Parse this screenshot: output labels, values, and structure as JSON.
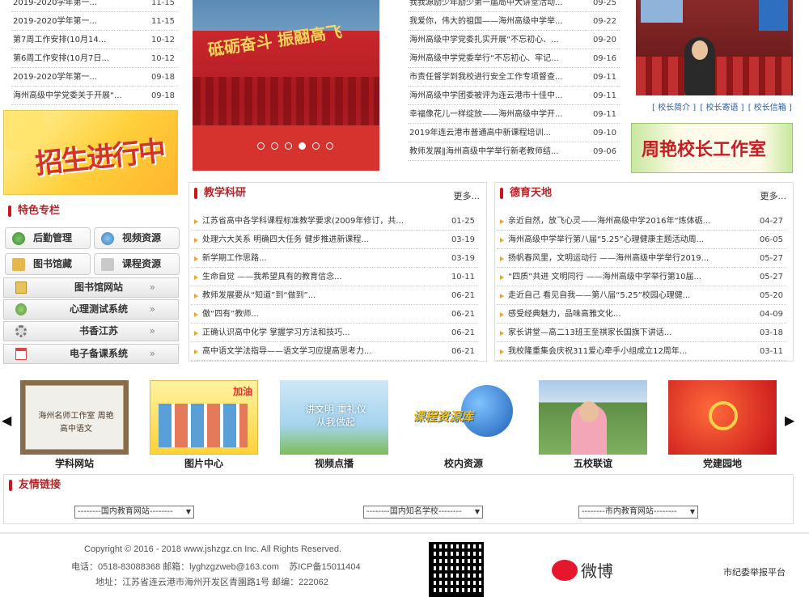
{
  "left_notices": [
    {
      "title": "2019-2020学年第一...",
      "date": "11-15"
    },
    {
      "title": "2019-2020学年第一...",
      "date": "11-15"
    },
    {
      "title": "第7周工作安排(10月14...",
      "date": "10-12"
    },
    {
      "title": "第6周工作安排(10月7日...",
      "date": "10-12"
    },
    {
      "title": "2019-2020学年第一...",
      "date": "09-18"
    },
    {
      "title": "海州高级中学党委关于开展“...",
      "date": "09-18"
    }
  ],
  "banner": {
    "text": "招生进行中"
  },
  "slideshow": {
    "caption": "砥砺奋斗 振翮高飞",
    "dots": 6,
    "active_dot": 4
  },
  "center_news": [
    {
      "title": "我我源励少年励少第一届局中大讲堂活动...",
      "date": "09-25"
    },
    {
      "title": "我爱你，伟大的祖国——海州高级中学举...",
      "date": "09-22"
    },
    {
      "title": "海州高级中学党委扎实开展“不忘初心、...",
      "date": "09-20"
    },
    {
      "title": "海州高级中学党委举行“不忘初心、牢记...",
      "date": "09-16"
    },
    {
      "title": "市责任督学到我校进行安全工作专项督查...",
      "date": "09-11"
    },
    {
      "title": "海州高级中学团委被评为连云港市十佳中...",
      "date": "09-11"
    },
    {
      "title": "幸福像花儿一样绽放——海州高级中学开...",
      "date": "09-11"
    },
    {
      "title": "2019年连云港市普通高中新课程培训...",
      "date": "09-10"
    },
    {
      "title": "教师发展‖海州高级中学举行新老教师结...",
      "date": "09-06"
    }
  ],
  "principal": {
    "links": [
      "[ 校长简介 ]",
      "[ 校长寄语 ]",
      "[ 校长信箱 ]"
    ],
    "studio_banner": "周艳校长工作室"
  },
  "special": {
    "title": "特色专栏",
    "small_buttons": [
      "后勤管理",
      "视频资源",
      "图书馆藏",
      "课程资源"
    ],
    "wide_buttons": [
      "图书馆网站",
      "心理测试系统",
      "书香江苏",
      "电子备课系统"
    ],
    "chevron": "»"
  },
  "teaching": {
    "title": "教学科研",
    "more": "更多",
    "items": [
      {
        "title": "江苏省高中各学科课程标准教学要求(2009年修订，共...",
        "date": "01-25"
      },
      {
        "title": "处理六大关系 明确四大任务 健步推进新课程...",
        "date": "03-19"
      },
      {
        "title": "新学期工作思路...",
        "date": "03-19"
      },
      {
        "title": "生命自觉 ——我希望具有的教育信念...",
        "date": "10-11"
      },
      {
        "title": "教师发展要从“知道”到“做到”...",
        "date": "06-21"
      },
      {
        "title": "傲“四有”教师...",
        "date": "06-21"
      },
      {
        "title": "正确认识高中化学 掌握学习方法和技巧...",
        "date": "06-21"
      },
      {
        "title": "高中语文学法指导——语文学习应提高思考力...",
        "date": "06-21"
      }
    ]
  },
  "moral": {
    "title": "德育天地",
    "more": "更多",
    "items": [
      {
        "title": "亲近自然，放飞心灵——海州高级中学2016年“炼体砺...",
        "date": "04-27"
      },
      {
        "title": "海州高级中学举行第八届“5.25”心理健康主题活动周...",
        "date": "06-05"
      },
      {
        "title": "扬帆春风里，文明运动行 ——海州高级中学举行2019...",
        "date": "05-27"
      },
      {
        "title": "“四质”共进 文明同行 ——海州高级中学举行第10届...",
        "date": "05-27"
      },
      {
        "title": "走近自己 看见自我——第八届“5.25”校园心理健...",
        "date": "05-20"
      },
      {
        "title": "感受经典魅力，品味高雅文化...",
        "date": "04-09"
      },
      {
        "title": "家长讲堂—高二13班王至祺家长国旗下讲话...",
        "date": "03-18"
      },
      {
        "title": "我校隆重集会庆祝311爱心牵手小组成立12周年...",
        "date": "03-11"
      }
    ]
  },
  "gallery": {
    "items": [
      {
        "caption": "学科网站",
        "text": "海州名师工作室 周艳 高中语文"
      },
      {
        "caption": "图片中心",
        "text": "加油"
      },
      {
        "caption": "视频点播",
        "text": "讲文明 重礼仪 从我做起"
      },
      {
        "caption": "校内资源",
        "text": "课程资源库"
      },
      {
        "caption": "五校联谊",
        "text": ""
      },
      {
        "caption": "党建园地",
        "text": ""
      }
    ],
    "prev": "◀",
    "next": "▶"
  },
  "links": {
    "title": "友情链接",
    "selects": [
      "--------国内教育网站--------",
      "--------国内知名学校--------",
      "--------市内教育网站--------"
    ]
  },
  "footer": {
    "copyright": "Copyright © 2016 - 2018 www.jshzgz.cn Inc. All Rights Reserved.",
    "contact": "电话：0518-83088368 邮箱：lyghzgzweb@163.com    苏ICP备15011404",
    "address": "地址：江苏省连云港市海州开发区青園路1号 邮编：222062",
    "weibo": "微博",
    "report": "市纪委举报平台"
  }
}
